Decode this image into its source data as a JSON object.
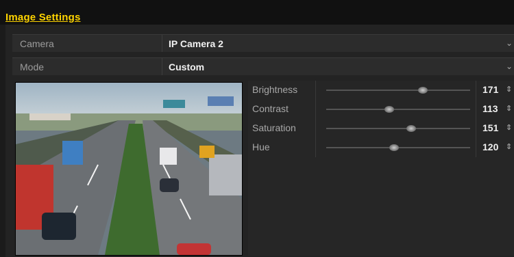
{
  "title": "Image Settings",
  "fields": [
    {
      "label": "Camera",
      "value": "IP Camera 2"
    },
    {
      "label": "Mode",
      "value": "Custom"
    }
  ],
  "adjustments": [
    {
      "label": "Brightness",
      "value": "171",
      "level": 0.67
    },
    {
      "label": "Contrast",
      "value": "113",
      "level": 0.44
    },
    {
      "label": "Saturation",
      "value": "151",
      "level": 0.59
    },
    {
      "label": "Hue",
      "value": "120",
      "level": 0.47
    }
  ],
  "colors": {
    "title": "#ffd400",
    "background": "#1b1b1b"
  },
  "icons": {
    "dropdown": "chevron-down-icon",
    "spinner": "spinner-arrows-icon"
  }
}
